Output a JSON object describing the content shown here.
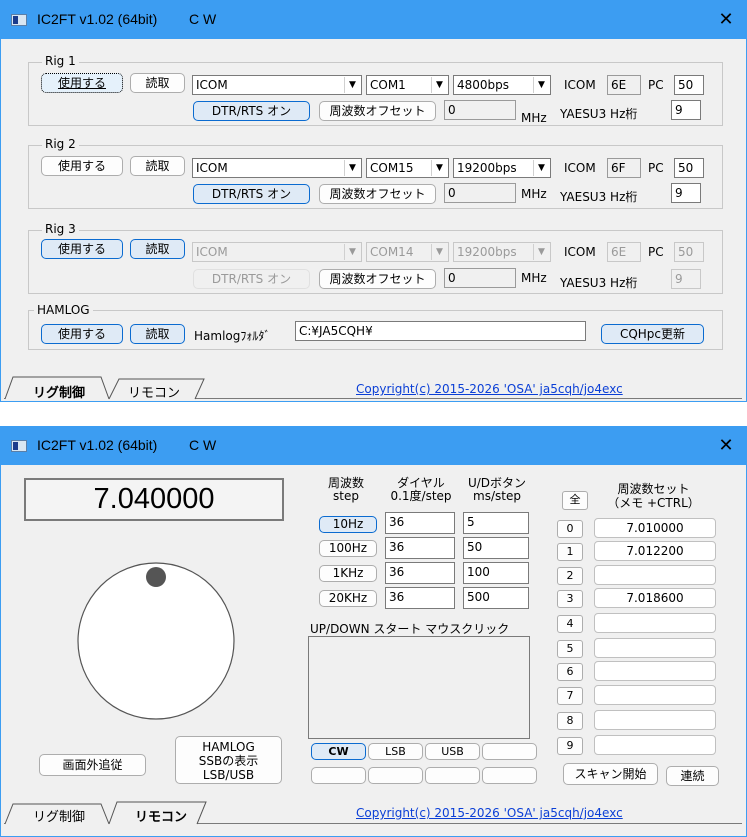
{
  "window1": {
    "title": "IC2FT v1.02 (64bit)",
    "mode": "C W",
    "close": "✕",
    "rigs": [
      {
        "group": "Rig 1",
        "use": "使用する",
        "read": "読取",
        "maker": "ICOM",
        "port": "COM1",
        "baud": "4800bps",
        "addr_label": "ICOM",
        "addr": "6E",
        "pc_label": "PC",
        "pc": "50",
        "dtr": "DTR/RTS オン",
        "offset_btn": "周波数オフセット",
        "offset": "0",
        "mhz": "MHz",
        "yaesu_label": "YAESU3 Hz桁",
        "yaesu": "9"
      },
      {
        "group": "Rig 2",
        "use": "使用する",
        "read": "読取",
        "maker": "ICOM",
        "port": "COM15",
        "baud": "19200bps",
        "addr_label": "ICOM",
        "addr": "6F",
        "pc_label": "PC",
        "pc": "50",
        "dtr": "DTR/RTS オン",
        "offset_btn": "周波数オフセット",
        "offset": "0",
        "mhz": "MHz",
        "yaesu_label": "YAESU3 Hz桁",
        "yaesu": "9"
      },
      {
        "group": "Rig 3",
        "use": "使用する",
        "read": "読取",
        "maker": "ICOM",
        "port": "COM14",
        "baud": "19200bps",
        "addr_label": "ICOM",
        "addr": "6E",
        "pc_label": "PC",
        "pc": "50",
        "dtr": "DTR/RTS オン",
        "offset_btn": "周波数オフセット",
        "offset": "0",
        "mhz": "MHz",
        "yaesu_label": "YAESU3 Hz桁",
        "yaesu": "9"
      }
    ],
    "hamlog": {
      "group": "HAMLOG",
      "use": "使用する",
      "read": "読取",
      "folder_label": "Hamlogﾌｫﾙﾀﾞ",
      "folder": "C:¥JA5CQH¥",
      "update": "CQHpc更新"
    },
    "tabs": {
      "rig": "リグ制御",
      "remote": "リモコン"
    },
    "copyright": "Copyright(c) 2015-2026 'OSA' ja5cqh/jo4exc"
  },
  "window2": {
    "title": "IC2FT v1.02 (64bit)",
    "mode": "C W",
    "close": "✕",
    "frequency": "7.040000",
    "offscreen": "画面外追従",
    "hamlog_ssb": {
      "l1": "HAMLOG",
      "l2": "SSBの表示",
      "l3": "LSB/USB"
    },
    "headers": {
      "step1": "周波数",
      "step2": "step",
      "dial1": "ダイヤル",
      "dial2": "0.1度/step",
      "ud1": "U/Dボタン",
      "ud2": "ms/step"
    },
    "steps": [
      {
        "label": "10Hz",
        "dial": "36",
        "ms": "5"
      },
      {
        "label": "100Hz",
        "dial": "36",
        "ms": "50"
      },
      {
        "label": "1KHz",
        "dial": "36",
        "ms": "100"
      },
      {
        "label": "20KHz",
        "dial": "36",
        "ms": "500"
      }
    ],
    "updown_label": "UP/DOWN スタート マウスクリック",
    "modes": [
      "CW",
      "LSB",
      "USB"
    ],
    "mem_header1": "周波数セット",
    "mem_header2": "（メモ +CTRL）",
    "all": "全",
    "memories": [
      {
        "n": "0",
        "f": "7.010000"
      },
      {
        "n": "1",
        "f": "7.012200"
      },
      {
        "n": "2",
        "f": ""
      },
      {
        "n": "3",
        "f": "7.018600"
      },
      {
        "n": "4",
        "f": ""
      },
      {
        "n": "5",
        "f": ""
      },
      {
        "n": "6",
        "f": ""
      },
      {
        "n": "7",
        "f": ""
      },
      {
        "n": "8",
        "f": ""
      },
      {
        "n": "9",
        "f": ""
      }
    ],
    "scan": "スキャン開始",
    "cont": "連続",
    "tabs": {
      "rig": "リグ制御",
      "remote": "リモコン"
    },
    "copyright": "Copyright(c) 2015-2026 'OSA' ja5cqh/jo4exc"
  }
}
